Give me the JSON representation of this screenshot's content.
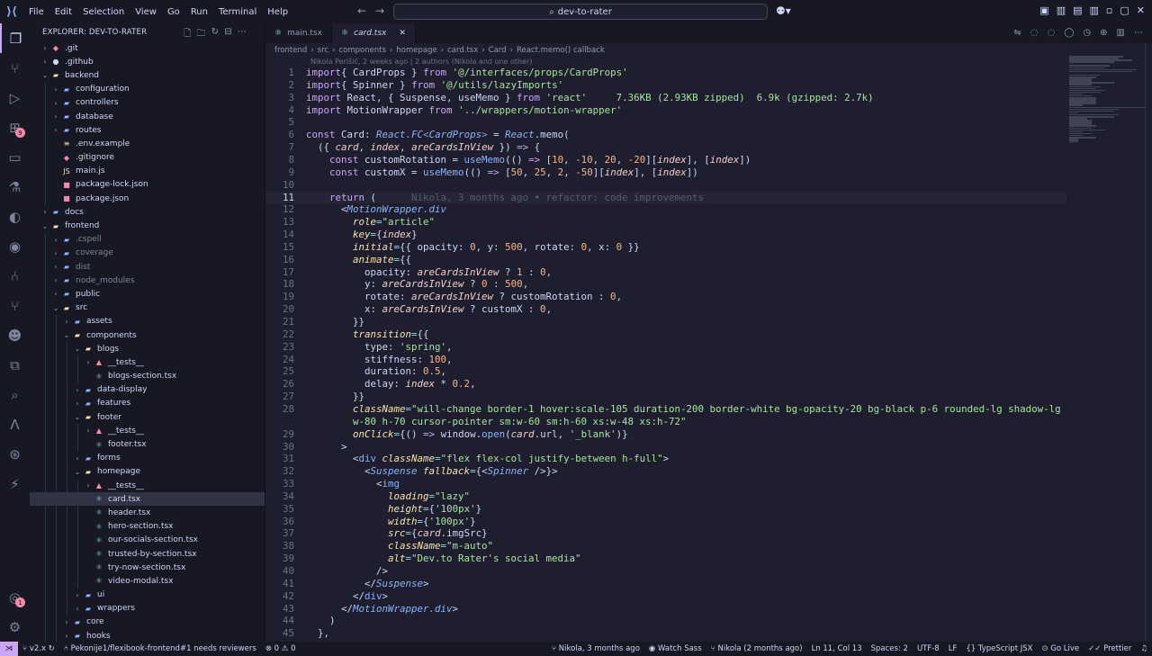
{
  "menu": [
    "File",
    "Edit",
    "Selection",
    "View",
    "Go",
    "Run",
    "Terminal",
    "Help"
  ],
  "search": {
    "label": "dev-to-rater"
  },
  "explorer": {
    "title": "EXPLORER: DEV-TO-RATER"
  },
  "tree": [
    {
      "label": ".git",
      "depth": 0,
      "kind": "folder",
      "open": false,
      "icon": "git",
      "dim": false
    },
    {
      "label": ".github",
      "depth": 0,
      "kind": "folder",
      "open": false,
      "icon": "github",
      "dim": false
    },
    {
      "label": "backend",
      "depth": 0,
      "kind": "folder",
      "open": true,
      "icon": "folder-open",
      "dim": false
    },
    {
      "label": "configuration",
      "depth": 1,
      "kind": "folder",
      "open": false,
      "icon": "folder",
      "dim": false
    },
    {
      "label": "controllers",
      "depth": 1,
      "kind": "folder",
      "open": false,
      "icon": "folder",
      "dim": false
    },
    {
      "label": "database",
      "depth": 1,
      "kind": "folder",
      "open": false,
      "icon": "folder",
      "dim": false
    },
    {
      "label": "routes",
      "depth": 1,
      "kind": "folder",
      "open": false,
      "icon": "folder",
      "dim": false
    },
    {
      "label": ".env.example",
      "depth": 1,
      "kind": "file",
      "icon": "env",
      "dim": false
    },
    {
      "label": ".gitignore",
      "depth": 1,
      "kind": "file",
      "icon": "git",
      "dim": false
    },
    {
      "label": "main.js",
      "depth": 1,
      "kind": "file",
      "icon": "js",
      "dim": false
    },
    {
      "label": "package-lock.json",
      "depth": 1,
      "kind": "file",
      "icon": "npm",
      "dim": false
    },
    {
      "label": "package.json",
      "depth": 1,
      "kind": "file",
      "icon": "npm",
      "dim": false
    },
    {
      "label": "docs",
      "depth": 0,
      "kind": "folder",
      "open": false,
      "icon": "folder",
      "dim": false
    },
    {
      "label": "frontend",
      "depth": 0,
      "kind": "folder",
      "open": true,
      "icon": "folder-open",
      "dim": false
    },
    {
      "label": ".cspell",
      "depth": 1,
      "kind": "folder",
      "open": false,
      "icon": "folder",
      "dim": true
    },
    {
      "label": "coverage",
      "depth": 1,
      "kind": "folder",
      "open": false,
      "icon": "folder",
      "dim": true
    },
    {
      "label": "dist",
      "depth": 1,
      "kind": "folder",
      "open": false,
      "icon": "folder",
      "dim": true
    },
    {
      "label": "node_modules",
      "depth": 1,
      "kind": "folder",
      "open": false,
      "icon": "folder",
      "dim": true
    },
    {
      "label": "public",
      "depth": 1,
      "kind": "folder",
      "open": false,
      "icon": "folder",
      "dim": false
    },
    {
      "label": "src",
      "depth": 1,
      "kind": "folder",
      "open": true,
      "icon": "folder-open",
      "dim": false
    },
    {
      "label": "assets",
      "depth": 2,
      "kind": "folder",
      "open": false,
      "icon": "folder",
      "dim": false
    },
    {
      "label": "components",
      "depth": 2,
      "kind": "folder",
      "open": true,
      "icon": "folder-open",
      "dim": false
    },
    {
      "label": "blogs",
      "depth": 3,
      "kind": "folder",
      "open": true,
      "icon": "folder-open",
      "dim": false
    },
    {
      "label": "__tests__",
      "depth": 4,
      "kind": "folder",
      "open": false,
      "icon": "test",
      "dim": false
    },
    {
      "label": "blogs-section.tsx",
      "depth": 4,
      "kind": "file",
      "icon": "react",
      "dim": false
    },
    {
      "label": "data-display",
      "depth": 3,
      "kind": "folder",
      "open": false,
      "icon": "folder",
      "dim": false
    },
    {
      "label": "features",
      "depth": 3,
      "kind": "folder",
      "open": false,
      "icon": "folder",
      "dim": false
    },
    {
      "label": "footer",
      "depth": 3,
      "kind": "folder",
      "open": true,
      "icon": "folder-open",
      "dim": false
    },
    {
      "label": "__tests__",
      "depth": 4,
      "kind": "folder",
      "open": false,
      "icon": "test",
      "dim": false
    },
    {
      "label": "footer.tsx",
      "depth": 4,
      "kind": "file",
      "icon": "react",
      "dim": false
    },
    {
      "label": "forms",
      "depth": 3,
      "kind": "folder",
      "open": false,
      "icon": "folder",
      "dim": false
    },
    {
      "label": "homepage",
      "depth": 3,
      "kind": "folder",
      "open": true,
      "icon": "folder-open",
      "dim": false
    },
    {
      "label": "__tests__",
      "depth": 4,
      "kind": "folder",
      "open": false,
      "icon": "test",
      "dim": false
    },
    {
      "label": "card.tsx",
      "depth": 4,
      "kind": "file",
      "icon": "react",
      "dim": false,
      "selected": true
    },
    {
      "label": "header.tsx",
      "depth": 4,
      "kind": "file",
      "icon": "react",
      "dim": false
    },
    {
      "label": "hero-section.tsx",
      "depth": 4,
      "kind": "file",
      "icon": "react",
      "dim": false
    },
    {
      "label": "our-socials-section.tsx",
      "depth": 4,
      "kind": "file",
      "icon": "react",
      "dim": false
    },
    {
      "label": "trusted-by-section.tsx",
      "depth": 4,
      "kind": "file",
      "icon": "react",
      "dim": false
    },
    {
      "label": "try-now-section.tsx",
      "depth": 4,
      "kind": "file",
      "icon": "react",
      "dim": false
    },
    {
      "label": "video-modal.tsx",
      "depth": 4,
      "kind": "file",
      "icon": "react",
      "dim": false
    },
    {
      "label": "ui",
      "depth": 3,
      "kind": "folder",
      "open": false,
      "icon": "folder",
      "dim": false
    },
    {
      "label": "wrappers",
      "depth": 3,
      "kind": "folder",
      "open": false,
      "icon": "folder",
      "dim": false
    },
    {
      "label": "core",
      "depth": 2,
      "kind": "folder",
      "open": false,
      "icon": "folder",
      "dim": false
    },
    {
      "label": "hooks",
      "depth": 2,
      "kind": "folder",
      "open": false,
      "icon": "folder",
      "dim": false
    }
  ],
  "tabs": [
    {
      "label": "main.tsx",
      "active": false
    },
    {
      "label": "card.tsx",
      "active": true
    }
  ],
  "breadcrumb": [
    "frontend",
    "src",
    "components",
    "homepage",
    "card.tsx",
    "Card",
    "React.memo() callback"
  ],
  "blame_header": "Nikola Perišić, 2 weeks ago | 2 authors (Nikola and one other)",
  "current_line": 11,
  "code": [
    [
      [
        "kw",
        "import"
      ],
      [
        "",
        "{ "
      ],
      [
        "",
        "CardProps"
      ],
      [
        "",
        " } "
      ],
      [
        "kw",
        "from"
      ],
      [
        "",
        " "
      ],
      [
        "str",
        "'@/interfaces/props/CardProps'"
      ]
    ],
    [
      [
        "kw",
        "import"
      ],
      [
        "",
        "{ "
      ],
      [
        "",
        "Spinner"
      ],
      [
        "",
        " } "
      ],
      [
        "kw",
        "from"
      ],
      [
        "",
        " "
      ],
      [
        "str",
        "'@/utils/lazyImports'"
      ]
    ],
    [
      [
        "kw",
        "import"
      ],
      [
        "",
        " React, { Suspense, useMemo } "
      ],
      [
        "kw",
        "from"
      ],
      [
        "",
        " "
      ],
      [
        "str",
        "'react'"
      ],
      [
        "",
        "     "
      ],
      [
        "size",
        "7.36KB (2.93KB zipped)"
      ],
      [
        "",
        "  "
      ],
      [
        "size",
        "6.9k (gzipped: 2.7k)"
      ]
    ],
    [
      [
        "kw",
        "import"
      ],
      [
        "",
        " MotionWrapper "
      ],
      [
        "kw",
        "from"
      ],
      [
        "",
        " "
      ],
      [
        "str",
        "'../wrappers/motion-wrapper'"
      ]
    ],
    [],
    [
      [
        "kw",
        "const"
      ],
      [
        "",
        " Card: "
      ],
      [
        "ty",
        "React.FC"
      ],
      [
        "punc",
        "<"
      ],
      [
        "ty",
        "CardProps"
      ],
      [
        "punc",
        ">"
      ],
      [
        "",
        " = "
      ],
      [
        "ty",
        "React"
      ],
      [
        "",
        ".memo("
      ]
    ],
    [
      [
        "",
        "  ({ "
      ],
      [
        "var",
        "card"
      ],
      [
        "",
        ", "
      ],
      [
        "var",
        "index"
      ],
      [
        "",
        ", "
      ],
      [
        "var",
        "areCardsInView"
      ],
      [
        "",
        " }) "
      ],
      [
        "kw",
        "=>"
      ],
      [
        "",
        " {"
      ]
    ],
    [
      [
        "",
        "    "
      ],
      [
        "kw",
        "const"
      ],
      [
        "",
        " customRotation = "
      ],
      [
        "fn",
        "useMemo"
      ],
      [
        "",
        "(() "
      ],
      [
        "kw",
        "=>"
      ],
      [
        "",
        " ["
      ],
      [
        "num",
        "10"
      ],
      [
        "",
        ", "
      ],
      [
        "num",
        "-10"
      ],
      [
        "",
        ", "
      ],
      [
        "num",
        "20"
      ],
      [
        "",
        ", "
      ],
      [
        "num",
        "-20"
      ],
      [
        "",
        "]["
      ],
      [
        "var",
        "index"
      ],
      [
        "",
        "], ["
      ],
      [
        "var",
        "index"
      ],
      [
        "",
        "])"
      ]
    ],
    [
      [
        "",
        "    "
      ],
      [
        "kw",
        "const"
      ],
      [
        "",
        " customX = "
      ],
      [
        "fn",
        "useMemo"
      ],
      [
        "",
        "(() "
      ],
      [
        "kw",
        "=>"
      ],
      [
        "",
        " ["
      ],
      [
        "num",
        "50"
      ],
      [
        "",
        ", "
      ],
      [
        "num",
        "25"
      ],
      [
        "",
        ", "
      ],
      [
        "num",
        "2"
      ],
      [
        "",
        ", "
      ],
      [
        "num",
        "-50"
      ],
      [
        "",
        "]["
      ],
      [
        "var",
        "index"
      ],
      [
        "",
        "], ["
      ],
      [
        "var",
        "index"
      ],
      [
        "",
        "])"
      ]
    ],
    [],
    [
      [
        "",
        "    "
      ],
      [
        "kw",
        "return"
      ],
      [
        "",
        " ("
      ],
      [
        "ghost",
        "      Nikola, 3 months ago • refactor: code improvements"
      ]
    ],
    [
      [
        "",
        "      <"
      ],
      [
        "tag",
        "MotionWrapper.div"
      ]
    ],
    [
      [
        "",
        "        "
      ],
      [
        "at",
        "role"
      ],
      [
        "op",
        "="
      ],
      [
        "str",
        "\"article\""
      ]
    ],
    [
      [
        "",
        "        "
      ],
      [
        "at",
        "key"
      ],
      [
        "op",
        "="
      ],
      [
        "",
        "{"
      ],
      [
        "var",
        "index"
      ],
      [
        "",
        "}"
      ]
    ],
    [
      [
        "",
        "        "
      ],
      [
        "at",
        "initial"
      ],
      [
        "op",
        "="
      ],
      [
        "",
        "{{ opacity: "
      ],
      [
        "num",
        "0"
      ],
      [
        "",
        ", y: "
      ],
      [
        "num",
        "500"
      ],
      [
        "",
        ", rotate: "
      ],
      [
        "num",
        "0"
      ],
      [
        "",
        ", x: "
      ],
      [
        "num",
        "0"
      ],
      [
        "",
        " }}"
      ]
    ],
    [
      [
        "",
        "        "
      ],
      [
        "at",
        "animate"
      ],
      [
        "op",
        "="
      ],
      [
        "",
        "{{"
      ]
    ],
    [
      [
        "",
        "          opacity: "
      ],
      [
        "var",
        "areCardsInView"
      ],
      [
        "",
        " ? "
      ],
      [
        "num",
        "1"
      ],
      [
        "",
        " : "
      ],
      [
        "num",
        "0"
      ],
      [
        "",
        ","
      ]
    ],
    [
      [
        "",
        "          y: "
      ],
      [
        "var",
        "areCardsInView"
      ],
      [
        "",
        " ? "
      ],
      [
        "num",
        "0"
      ],
      [
        "",
        " : "
      ],
      [
        "num",
        "500"
      ],
      [
        "",
        ","
      ]
    ],
    [
      [
        "",
        "          rotate: "
      ],
      [
        "var",
        "areCardsInView"
      ],
      [
        "",
        " ? customRotation : "
      ],
      [
        "num",
        "0"
      ],
      [
        "",
        ","
      ]
    ],
    [
      [
        "",
        "          x: "
      ],
      [
        "var",
        "areCardsInView"
      ],
      [
        "",
        " ? customX : "
      ],
      [
        "num",
        "0"
      ],
      [
        "",
        ","
      ]
    ],
    [
      [
        "",
        "        }}"
      ]
    ],
    [
      [
        "",
        "        "
      ],
      [
        "at",
        "transition"
      ],
      [
        "op",
        "="
      ],
      [
        "",
        "{{"
      ]
    ],
    [
      [
        "",
        "          type: "
      ],
      [
        "str",
        "'spring'"
      ],
      [
        "",
        ","
      ]
    ],
    [
      [
        "",
        "          stiffness: "
      ],
      [
        "num",
        "100"
      ],
      [
        "",
        ","
      ]
    ],
    [
      [
        "",
        "          duration: "
      ],
      [
        "num",
        "0.5"
      ],
      [
        "",
        ","
      ]
    ],
    [
      [
        "",
        "          delay: "
      ],
      [
        "var",
        "index"
      ],
      [
        "",
        " * "
      ],
      [
        "num",
        "0.2"
      ],
      [
        "",
        ","
      ]
    ],
    [
      [
        "",
        "        }}"
      ]
    ],
    [
      [
        "",
        "        "
      ],
      [
        "at",
        "className"
      ],
      [
        "op",
        "="
      ],
      [
        "str",
        "\"will-change border-1 hover:scale-105 duration-200 border-white bg-opacity-20 bg-black p-6 rounded-lg shadow-lg"
      ]
    ],
    [
      [
        "str",
        "        w-80 h-70 cursor-pointer sm:w-60 sm:h-60 xs:w-48 xs:h-72\""
      ]
    ],
    [
      [
        "",
        "        "
      ],
      [
        "at",
        "onClick"
      ],
      [
        "op",
        "="
      ],
      [
        "",
        "{() "
      ],
      [
        "kw",
        "=>"
      ],
      [
        "",
        " window."
      ],
      [
        "fn",
        "open"
      ],
      [
        "",
        "("
      ],
      [
        "var",
        "card"
      ],
      [
        "",
        ".url, "
      ],
      [
        "str",
        "'_blank'"
      ],
      [
        "",
        ")}"
      ]
    ],
    [
      [
        "",
        "      >"
      ]
    ],
    [
      [
        "",
        "        <"
      ],
      [
        "fn",
        "div"
      ],
      [
        "",
        " "
      ],
      [
        "at",
        "className"
      ],
      [
        "op",
        "="
      ],
      [
        "str",
        "\"flex flex-col justify-between h-full\""
      ],
      [
        "",
        ">"
      ]
    ],
    [
      [
        "",
        "          <"
      ],
      [
        "tag",
        "Suspense"
      ],
      [
        "",
        " "
      ],
      [
        "at",
        "fallback"
      ],
      [
        "op",
        "="
      ],
      [
        "",
        "{<"
      ],
      [
        "tag",
        "Spinner"
      ],
      [
        "",
        " />}>"
      ]
    ],
    [
      [
        "",
        "            <"
      ],
      [
        "fn",
        "img"
      ]
    ],
    [
      [
        "",
        "              "
      ],
      [
        "at",
        "loading"
      ],
      [
        "op",
        "="
      ],
      [
        "str",
        "\"lazy\""
      ]
    ],
    [
      [
        "",
        "              "
      ],
      [
        "at",
        "height"
      ],
      [
        "op",
        "="
      ],
      [
        "",
        "{"
      ],
      [
        "str",
        "'100px'"
      ],
      [
        "",
        "}"
      ]
    ],
    [
      [
        "",
        "              "
      ],
      [
        "at",
        "width"
      ],
      [
        "op",
        "="
      ],
      [
        "",
        "{"
      ],
      [
        "str",
        "'100px'"
      ],
      [
        "",
        "}"
      ]
    ],
    [
      [
        "",
        "              "
      ],
      [
        "at",
        "src"
      ],
      [
        "op",
        "="
      ],
      [
        "",
        "{"
      ],
      [
        "var",
        "card"
      ],
      [
        "",
        ".imgSrc}"
      ]
    ],
    [
      [
        "",
        "              "
      ],
      [
        "at",
        "className"
      ],
      [
        "op",
        "="
      ],
      [
        "str",
        "\"m-auto\""
      ]
    ],
    [
      [
        "",
        "              "
      ],
      [
        "at",
        "alt"
      ],
      [
        "op",
        "="
      ],
      [
        "str",
        "\"Dev.to Rater's social media\""
      ]
    ],
    [
      [
        "",
        "            />"
      ]
    ],
    [
      [
        "",
        "          </"
      ],
      [
        "tag",
        "Suspense"
      ],
      [
        "",
        ">"
      ]
    ],
    [
      [
        "",
        "        </"
      ],
      [
        "fn",
        "div"
      ],
      [
        "",
        ">"
      ]
    ],
    [
      [
        "",
        "      </"
      ],
      [
        "tag",
        "MotionWrapper.div"
      ],
      [
        "",
        ">"
      ]
    ],
    [
      [
        "",
        "    )"
      ]
    ],
    [
      [
        "",
        "  },"
      ]
    ]
  ],
  "line_numbers": [
    "1",
    "2",
    "3",
    "4",
    "5",
    "6",
    "7",
    "8",
    "9",
    "10",
    "11",
    "12",
    "13",
    "14",
    "15",
    "16",
    "17",
    "18",
    "19",
    "20",
    "21",
    "22",
    "23",
    "24",
    "25",
    "26",
    "27",
    "28",
    "",
    "29",
    "30",
    "31",
    "32",
    "33",
    "34",
    "35",
    "36",
    "37",
    "38",
    "39",
    "40",
    "41",
    "42",
    "43",
    "44",
    "45"
  ],
  "status": {
    "left": [
      "v2.x",
      "Pekonije1/flexibook-frontend#1 needs reviewers",
      "⊗ 0 ⚠ 0"
    ],
    "right": [
      "Nikola, 3 months ago",
      "Watch Sass",
      "Nikola (2 months ago)",
      "Ln 11, Col 13",
      "Spaces: 2",
      "UTF-8",
      "LF",
      "{} TypeScript JSX",
      "Go Live",
      "Prettier"
    ]
  },
  "activity_badges": {
    "extensions": "9",
    "account": "1"
  }
}
